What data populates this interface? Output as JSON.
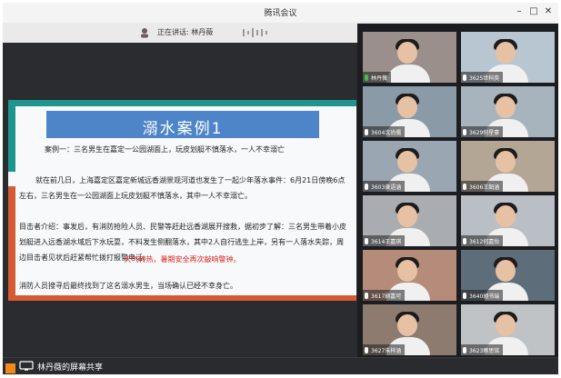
{
  "window": {
    "title": "腾讯会议",
    "minimize": "–",
    "maximize": "□",
    "close": "✕"
  },
  "speaking": {
    "text": "正在讲话: 林丹薇"
  },
  "slide": {
    "title": "溺水案例1",
    "paragraphs": [
      "案例一：三名男生在嘉定一公园湖面上，玩皮划艇不慎落水，一人不幸溺亡",
      "就在前几日，上海嘉定区嘉定新城远香湖景观河道也发生了一起少年落水事件：6月21日傍晚6点左右，三名男生在一公园湖面上玩皮划艇不慎落水，其中一人不幸溺亡。",
      "目击者介绍：事发后，有消防抢险人员、民警等赶赴远香湖展开搜救，据初步了解：三名男生带着小皮划艇进入远香湖水域后下水玩耍，不料发生侧翻落水，其中2人自行逃生上岸，另有一人落水失踪，周边目击者见状后赶紧帮忙拨打报警电话。",
      "消防人员搜寻后最终找到了这名溺水男生，当场确认已经不幸身亡。"
    ],
    "alert": "天气转热，暑期安全再次敲响警钟。"
  },
  "bottombar": {
    "share_text": "林丹薇的屏幕共享"
  },
  "participants": [
    {
      "name": "林丹薇",
      "mic": "green",
      "color": "#9a8f8a"
    },
    {
      "name": "3625世科奕",
      "mic": "white",
      "color": "#b8c6d2"
    },
    {
      "name": "3604沈尚儒",
      "mic": "white",
      "color": "#8a9aa6"
    },
    {
      "name": "3629何星豪",
      "mic": "white",
      "color": "#a7b4be"
    },
    {
      "name": "3603黄语涵",
      "mic": "white",
      "color": "#9aa7b3"
    },
    {
      "name": "3606王韶涵",
      "mic": "white",
      "color": "#b3a694"
    },
    {
      "name": "3614王嘉琪",
      "mic": "white",
      "color": "#a9adb1"
    },
    {
      "name": "3612何嘉怡",
      "mic": "white",
      "color": "#b9bfc4"
    },
    {
      "name": "3617顾嘉可",
      "mic": "white",
      "color": "#b58b7a"
    },
    {
      "name": "3640胡书瑞",
      "mic": "white",
      "color": "#5e6d7a"
    },
    {
      "name": "3627朱梓涵",
      "mic": "white",
      "color": "#8c7b6e"
    },
    {
      "name": "3623蔡思铭",
      "mic": "white",
      "color": "#bfc3c6"
    }
  ]
}
